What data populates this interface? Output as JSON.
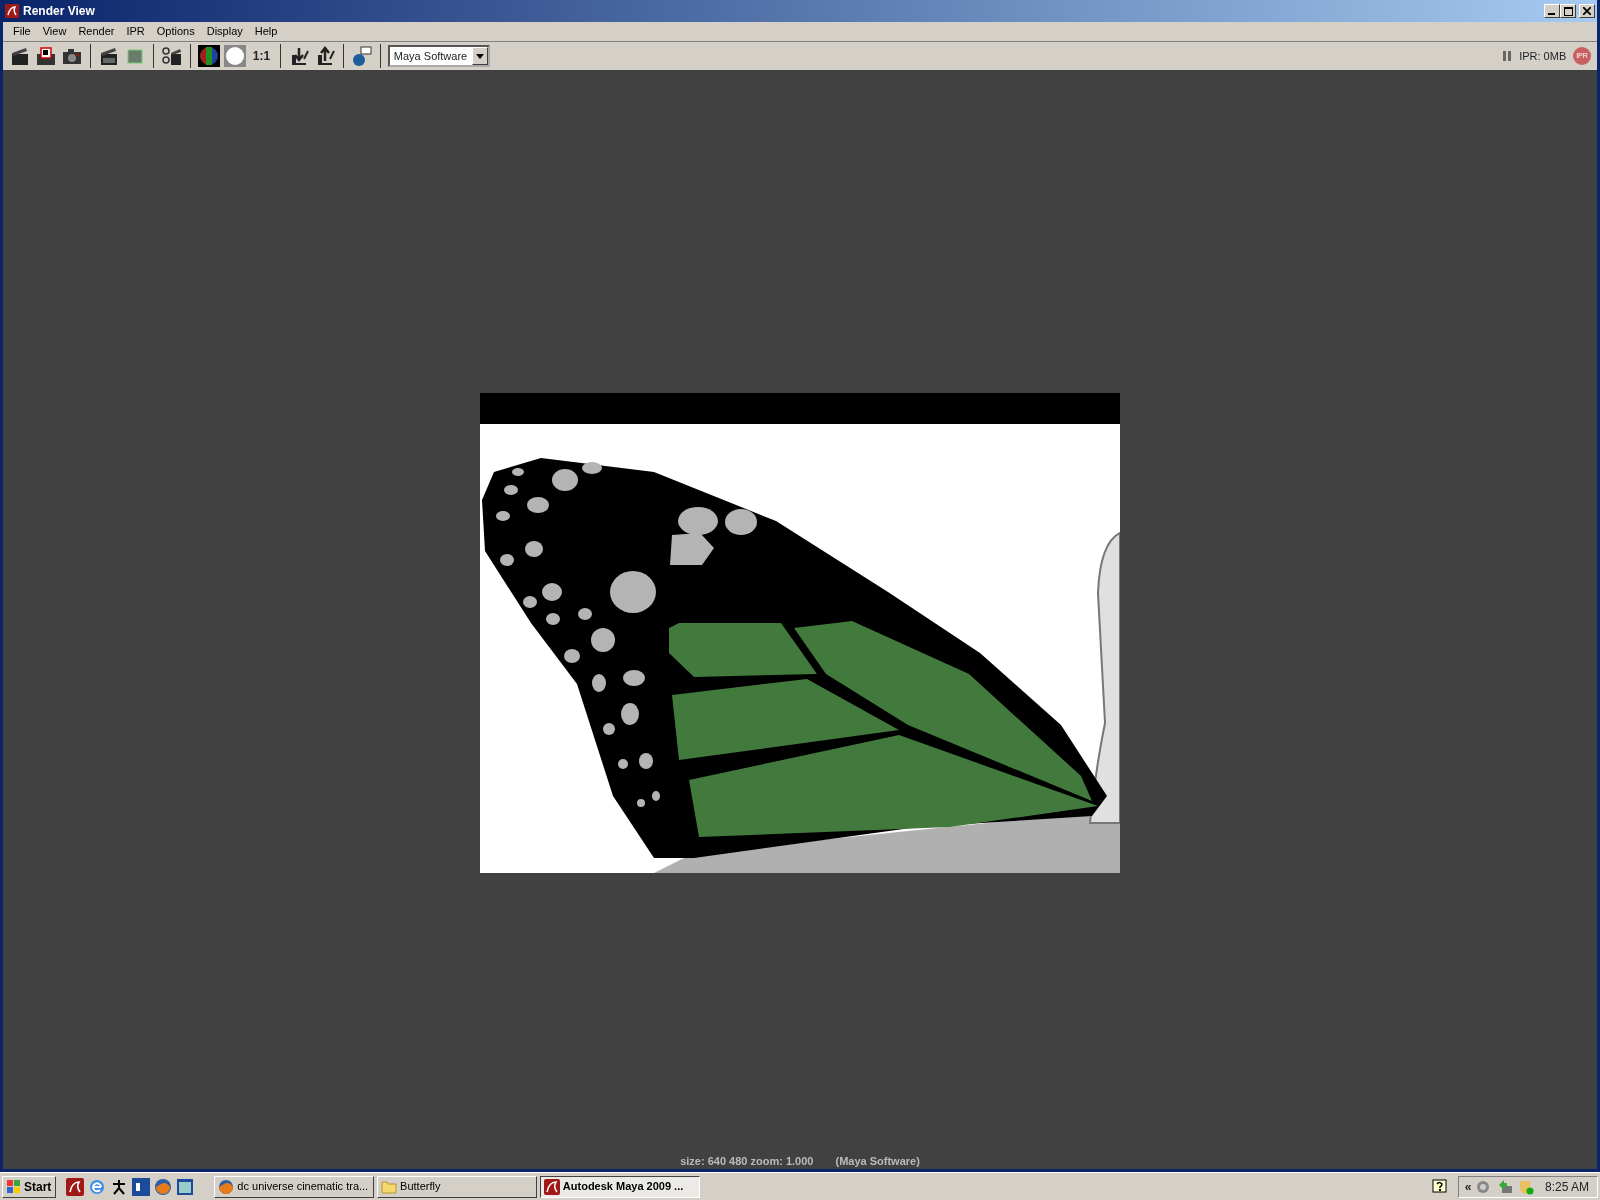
{
  "window": {
    "title": "Render View"
  },
  "menu": [
    "File",
    "View",
    "Render",
    "IPR",
    "Options",
    "Display",
    "Help"
  ],
  "toolbar": {
    "ratio_label": "1:1",
    "renderer": "Maya Software",
    "ipr_memory": "IPR: 0MB",
    "ipr_badge": "IPR"
  },
  "status_line": {
    "size": "size:  640  480 zoom: 1.000",
    "renderer": "(Maya Software)"
  },
  "taskbar": {
    "start": "Start",
    "tasks": [
      {
        "label": "dc universe cinematic tra...",
        "kind": "browser",
        "selected": false
      },
      {
        "label": "Butterfly",
        "kind": "folder",
        "selected": false
      },
      {
        "label": "Autodesk Maya 2009 ...",
        "kind": "maya",
        "selected": true
      }
    ],
    "tray_expand": "«",
    "clock": "8:25 AM"
  }
}
